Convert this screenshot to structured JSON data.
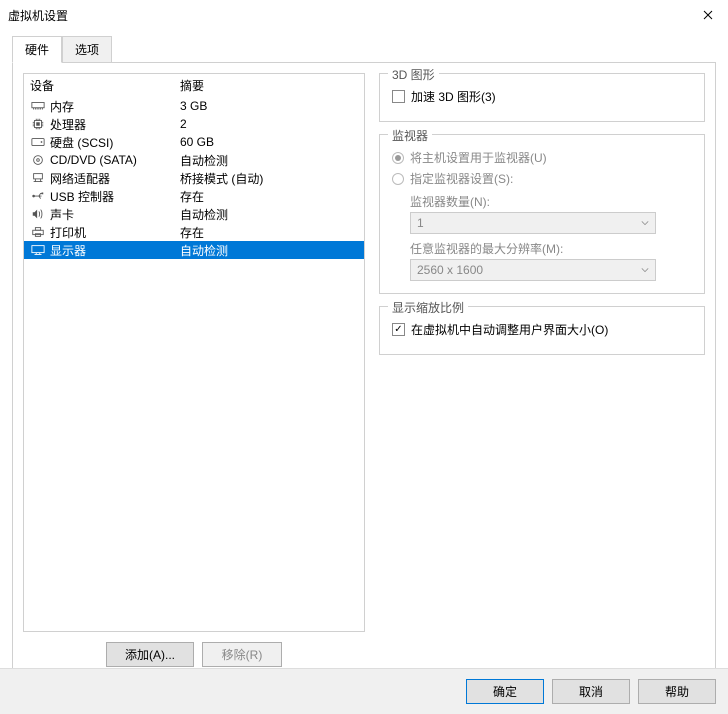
{
  "window": {
    "title": "虚拟机设置"
  },
  "tabs": {
    "hardware": "硬件",
    "options": "选项"
  },
  "deviceList": {
    "header": {
      "device": "设备",
      "summary": "摘要"
    },
    "items": [
      {
        "icon": "memory",
        "name": "内存",
        "summary": "3 GB"
      },
      {
        "icon": "cpu",
        "name": "处理器",
        "summary": "2"
      },
      {
        "icon": "hdd",
        "name": "硬盘 (SCSI)",
        "summary": "60 GB"
      },
      {
        "icon": "disc",
        "name": "CD/DVD (SATA)",
        "summary": "自动检测"
      },
      {
        "icon": "network",
        "name": "网络适配器",
        "summary": "桥接模式 (自动)"
      },
      {
        "icon": "usb",
        "name": "USB 控制器",
        "summary": "存在"
      },
      {
        "icon": "sound",
        "name": "声卡",
        "summary": "自动检测"
      },
      {
        "icon": "printer",
        "name": "打印机",
        "summary": "存在"
      },
      {
        "icon": "display",
        "name": "显示器",
        "summary": "自动检测"
      }
    ]
  },
  "buttons": {
    "add": "添加(A)...",
    "remove": "移除(R)"
  },
  "graphics3d": {
    "title": "3D 图形",
    "accelerateLabel": "加速 3D 图形(3)"
  },
  "monitors": {
    "title": "监视器",
    "useHost": "将主机设置用于监视器(U)",
    "specify": "指定监视器设置(S):",
    "countLabel": "监视器数量(N):",
    "countValue": "1",
    "maxResLabel": "任意监视器的最大分辨率(M):",
    "maxResValue": "2560 x 1600"
  },
  "scaling": {
    "title": "显示缩放比例",
    "autoLabel": "在虚拟机中自动调整用户界面大小(O)"
  },
  "dialog": {
    "ok": "确定",
    "cancel": "取消",
    "help": "帮助"
  }
}
